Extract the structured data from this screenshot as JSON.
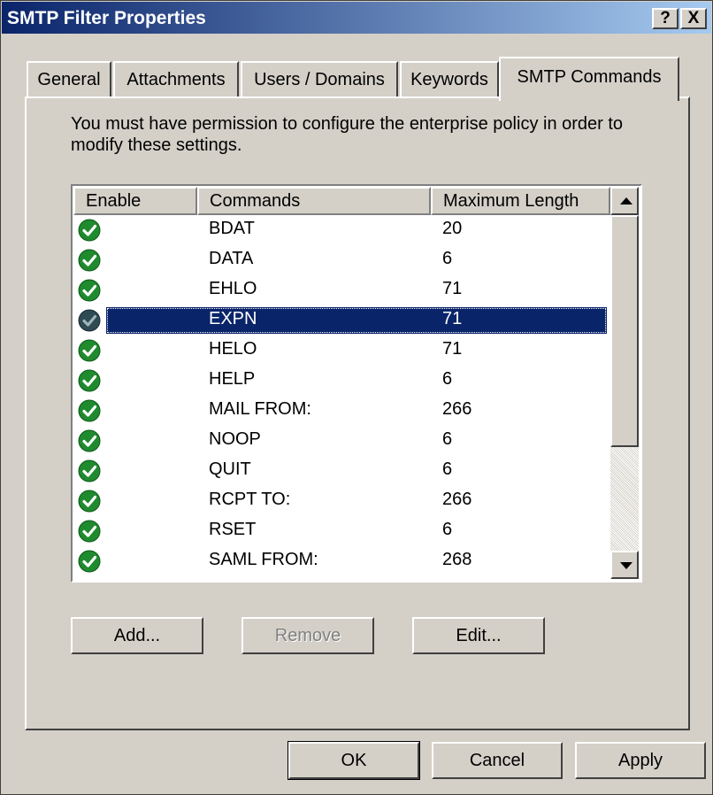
{
  "window": {
    "title": "SMTP Filter Properties",
    "help_button": "?",
    "close_button": "X"
  },
  "tabs": [
    {
      "label": "General",
      "active": false
    },
    {
      "label": "Attachments",
      "active": false
    },
    {
      "label": "Users / Domains",
      "active": false
    },
    {
      "label": "Keywords",
      "active": false
    },
    {
      "label": "SMTP Commands",
      "active": true
    }
  ],
  "info_text": "You must have permission to configure the enterprise policy in order to modify these settings.",
  "list": {
    "columns": [
      "Enable",
      "Commands",
      "Maximum Length"
    ],
    "rows": [
      {
        "enabled": true,
        "command": "BDAT",
        "max_length": "20",
        "selected": false
      },
      {
        "enabled": true,
        "command": "DATA",
        "max_length": "6",
        "selected": false
      },
      {
        "enabled": true,
        "command": "EHLO",
        "max_length": "71",
        "selected": false
      },
      {
        "enabled": true,
        "command": "EXPN",
        "max_length": "71",
        "selected": true
      },
      {
        "enabled": true,
        "command": "HELO",
        "max_length": "71",
        "selected": false
      },
      {
        "enabled": true,
        "command": "HELP",
        "max_length": "6",
        "selected": false
      },
      {
        "enabled": true,
        "command": "MAIL FROM:",
        "max_length": "266",
        "selected": false
      },
      {
        "enabled": true,
        "command": "NOOP",
        "max_length": "6",
        "selected": false
      },
      {
        "enabled": true,
        "command": "QUIT",
        "max_length": "6",
        "selected": false
      },
      {
        "enabled": true,
        "command": "RCPT TO:",
        "max_length": "266",
        "selected": false
      },
      {
        "enabled": true,
        "command": "RSET",
        "max_length": "6",
        "selected": false
      },
      {
        "enabled": true,
        "command": "SAML FROM:",
        "max_length": "268",
        "selected": false
      }
    ]
  },
  "actions": {
    "add": "Add...",
    "remove": "Remove",
    "edit": "Edit..."
  },
  "footer": {
    "ok": "OK",
    "cancel": "Cancel",
    "apply": "Apply"
  },
  "colors": {
    "titlebar_start": "#0a246a",
    "titlebar_end": "#a6caf0",
    "selection": "#0a246a",
    "check_green": "#1f8a2e"
  },
  "icons": {
    "enabled": "green-check-circle-icon",
    "scroll_up": "scroll-up-arrow-icon",
    "scroll_down": "scroll-down-arrow-icon"
  }
}
